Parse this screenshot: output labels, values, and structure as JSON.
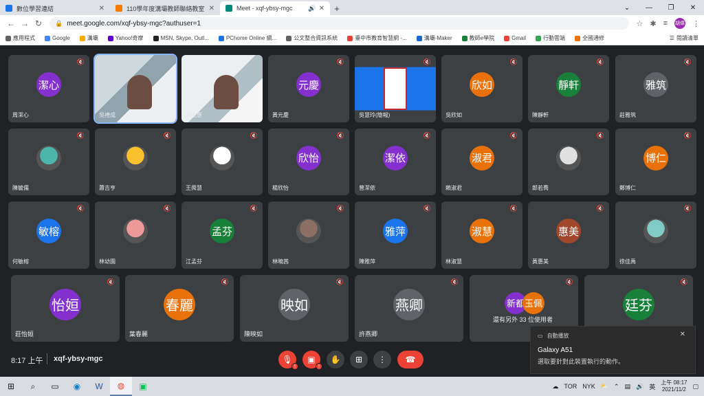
{
  "browser": {
    "tabs": [
      {
        "title": "數位學習連結",
        "fav": "#1a73e8",
        "active": false
      },
      {
        "title": "110學年度溝壩教師聯絡教室",
        "fav": "#f57c00",
        "active": false
      },
      {
        "title": "Meet - xqf-ybsy-mgc",
        "fav": "#00897b",
        "active": true
      }
    ],
    "url": "meet.google.com/xqf-ybsy-mgc?authuser=1",
    "profile_label": "胡偉",
    "bookmarks": [
      "應用程式",
      "Google",
      "溝壩",
      "Yahoo!奇摩",
      "MSN, Skype, Outl...",
      "PChome Online 網...",
      "公文整合資訊系統",
      "臺中市教育智慧網 -...",
      "溝壩-Maker",
      "教師e學院",
      "Gmail",
      "行動雲端",
      "全國通修"
    ],
    "bookmarks_right": "閱讀清單"
  },
  "tiles": [
    {
      "initials": "潔心",
      "name": "周潔心",
      "color": "#8430ce"
    },
    {
      "initials": "",
      "name": "吳禮成",
      "color": "#5c6bc0",
      "video": true
    },
    {
      "initials": "",
      "name": "吳德惠",
      "color": "#5c6bc0",
      "video": true
    },
    {
      "initials": "元慶",
      "name": "黃元慶",
      "color": "#8430ce"
    },
    {
      "initials": "",
      "name": "吳慧玲(簡報)",
      "color": "#1a73e8",
      "video": true
    },
    {
      "initials": "欣如",
      "name": "吳欣如",
      "color": "#e8710a"
    },
    {
      "initials": "靜軒",
      "name": "陳靜軒",
      "color": "#188038"
    },
    {
      "initials": "雅筑",
      "name": "莊雅筑",
      "color": "#5f6368"
    },
    {
      "initials": "",
      "name": "陳毓儒",
      "color": "#4db6ac",
      "pic": true
    },
    {
      "initials": "",
      "name": "蕭吉亨",
      "color": "#fbc02d",
      "pic": true
    },
    {
      "initials": "",
      "name": "王舜慧",
      "color": "#ffffff",
      "pic": true
    },
    {
      "initials": "欣怡",
      "name": "楊欣怡",
      "color": "#8430ce"
    },
    {
      "initials": "潔依",
      "name": "曾潔依",
      "color": "#8430ce"
    },
    {
      "initials": "淑君",
      "name": "賴淑君",
      "color": "#e8710a"
    },
    {
      "initials": "",
      "name": "郎若喬",
      "color": "#e0e0e0",
      "pic": true
    },
    {
      "initials": "博仁",
      "name": "鄭博仁",
      "color": "#e8710a"
    },
    {
      "initials": "敏榕",
      "name": "何敏榕",
      "color": "#1a73e8"
    },
    {
      "initials": "",
      "name": "林幼園",
      "color": "#ef9a9a",
      "pic": true
    },
    {
      "initials": "孟芬",
      "name": "江孟芬",
      "color": "#188038"
    },
    {
      "initials": "",
      "name": "林曉茜",
      "color": "#8d6e63",
      "pic": true
    },
    {
      "initials": "雅萍",
      "name": "陳雅萍",
      "color": "#1a73e8"
    },
    {
      "initials": "淑慧",
      "name": "林淑慧",
      "color": "#e8710a"
    },
    {
      "initials": "惠美",
      "name": "黃惠美",
      "color": "#a0462b"
    },
    {
      "initials": "",
      "name": "徐佳禹",
      "color": "#80cbc4",
      "pic": true
    },
    {
      "initials": "怡姮",
      "name": "莊怡姮",
      "color": "#8430ce"
    },
    {
      "initials": "春麗",
      "name": "葉春麗",
      "color": "#e8710a"
    },
    {
      "initials": "映如",
      "name": "陳映如",
      "color": "#5f6368"
    },
    {
      "initials": "燕卿",
      "name": "許燕卿",
      "color": "#5f6368"
    },
    {
      "initials": "",
      "name": "還有另外 33 位使用者",
      "color": "#5f6368",
      "others": true,
      "chips": [
        {
          "t": "新都",
          "c": "#8430ce"
        },
        {
          "t": "玉佩",
          "c": "#e8710a"
        }
      ]
    },
    {
      "initials": "廷芬",
      "name": "",
      "color": "#188038"
    }
  ],
  "bottombar": {
    "time": "8:17 上午",
    "meeting_code": "xqf-ybsy-mgc"
  },
  "notification": {
    "header": "自動播放",
    "title": "Galaxy A51",
    "body": "選取要針對此裝置執行的動作。"
  },
  "taskbar": {
    "tray_weather_1": "TOR",
    "tray_weather_2": "NYK",
    "ime": "英",
    "time": "上午 08:17",
    "date": "2021/11/2"
  }
}
